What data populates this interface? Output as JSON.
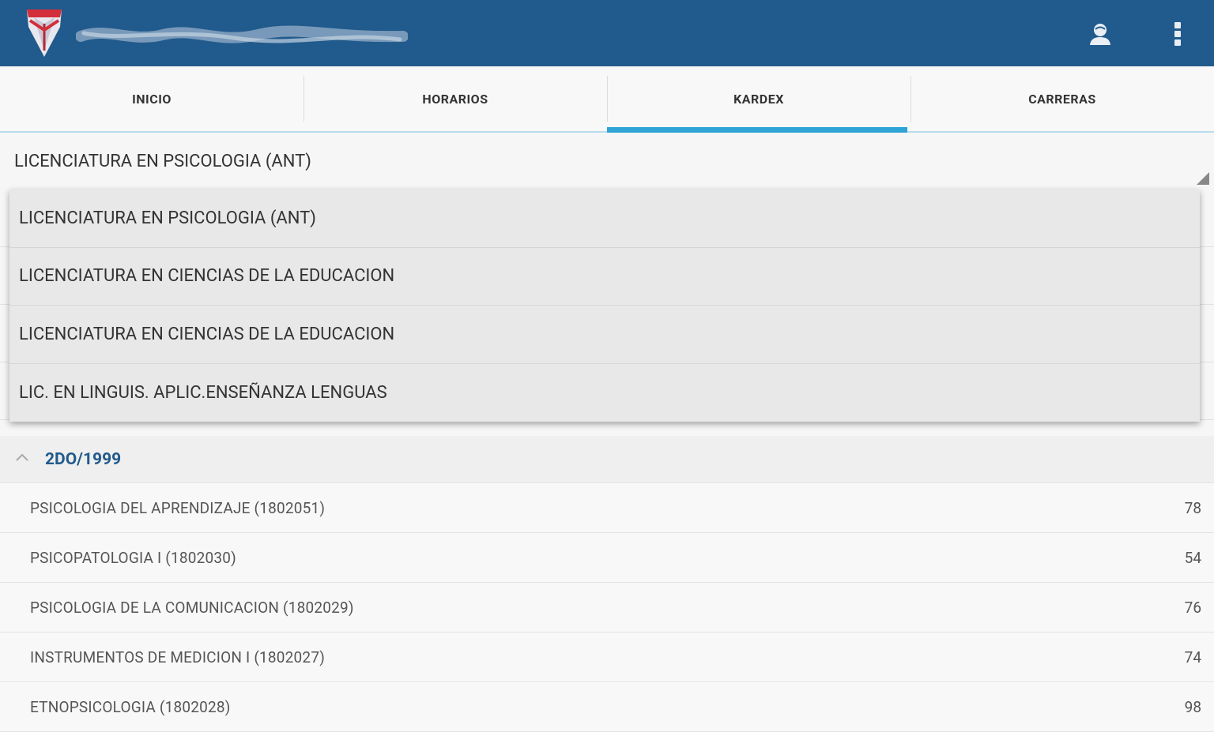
{
  "colors": {
    "actionbar": "#215a8c",
    "tab_indicator": "#2ea3d6",
    "group_title": "#215a8c"
  },
  "header": {
    "logo_icon": "university-shield-logo",
    "user_icon": "user-icon",
    "menu_icon": "more-vert-icon"
  },
  "tabs": [
    {
      "label": "INICIO"
    },
    {
      "label": "HORARIOS"
    },
    {
      "label": "KARDEX"
    },
    {
      "label": "CARRERAS"
    }
  ],
  "spinner": {
    "selected": "LICENCIATURA EN PSICOLOGIA (ANT)"
  },
  "dropdown": {
    "options": [
      "LICENCIATURA EN PSICOLOGIA (ANT)",
      "LICENCIATURA EN CIENCIAS DE LA EDUCACION",
      "LICENCIATURA EN CIENCIAS DE LA EDUCACION",
      "LIC. EN LINGUIS. APLIC.ENSEÑANZA LENGUAS"
    ]
  },
  "group": {
    "title": "2DO/1999"
  },
  "subjects": [
    {
      "name": "PSICOLOGIA DEL APRENDIZAJE (1802051)",
      "grade": "78"
    },
    {
      "name": "PSICOPATOLOGIA I (1802030)",
      "grade": "54"
    },
    {
      "name": "PSICOLOGIA DE LA COMUNICACION (1802029)",
      "grade": "76"
    },
    {
      "name": "INSTRUMENTOS DE MEDICION I (1802027)",
      "grade": "74"
    },
    {
      "name": "ETNOPSICOLOGIA (1802028)",
      "grade": "98"
    }
  ]
}
